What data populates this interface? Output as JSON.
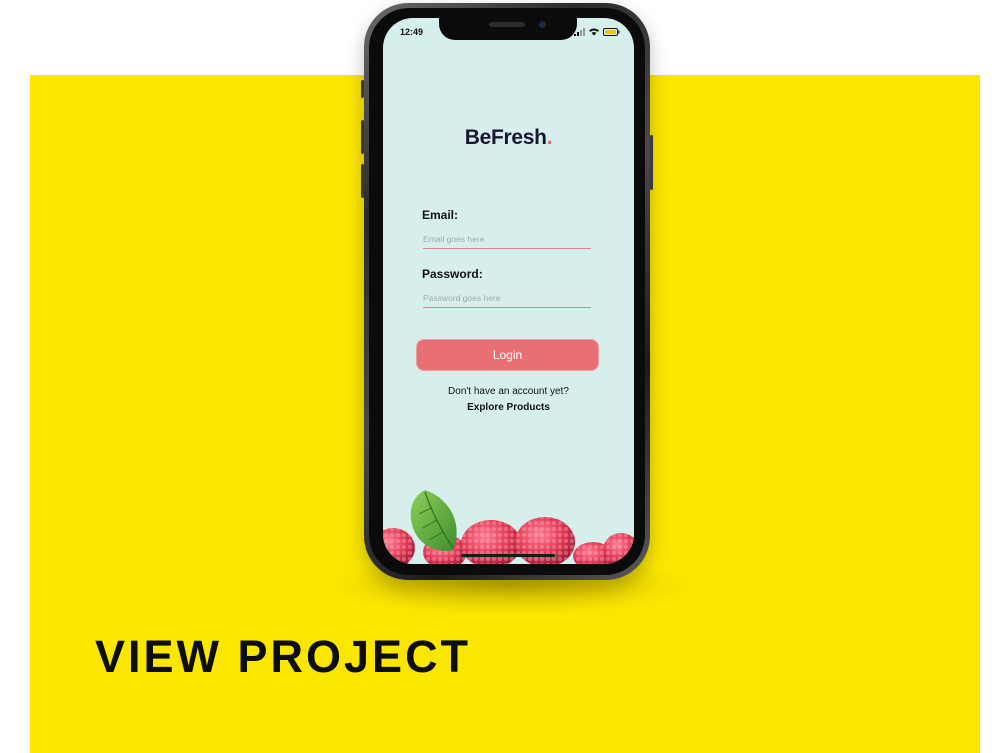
{
  "colors": {
    "background_panel": "#fbe600",
    "screen_background": "#d7efec",
    "accent": "#e87073",
    "logo_text": "#1b1534"
  },
  "status_bar": {
    "time": "12:49",
    "icons": [
      "signal-icon",
      "wifi-icon",
      "battery-icon"
    ]
  },
  "app": {
    "logo_text": "BeFresh",
    "logo_dot": ".",
    "email": {
      "label": "Email:",
      "placeholder": "Email goes here",
      "value": ""
    },
    "password": {
      "label": "Password:",
      "placeholder": "Password goes here",
      "value": ""
    },
    "login_button": "Login",
    "signup_prompt": "Don't have an account yet?",
    "explore_link": "Explore Products"
  },
  "decor": {
    "fruit_image": "raspberries-with-leaf"
  },
  "cta": {
    "label": "VIEW PROJECT"
  }
}
